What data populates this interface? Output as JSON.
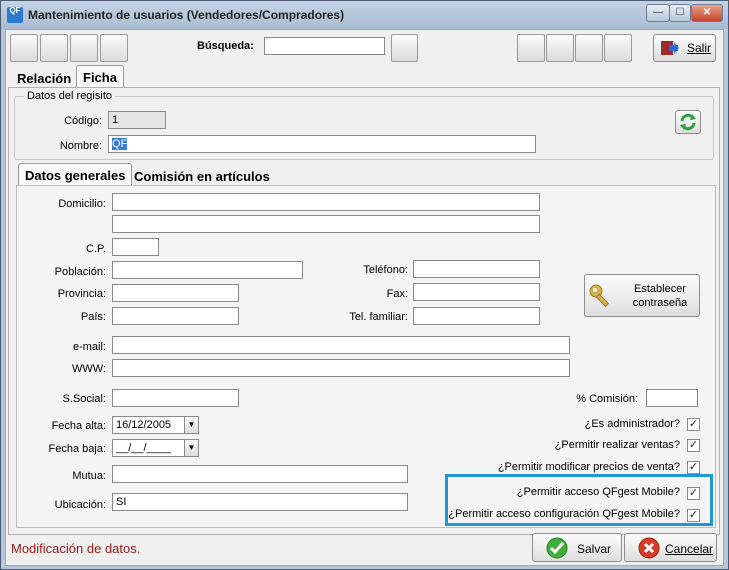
{
  "window": {
    "title": "Mantenimiento de usuarios (Vendedores/Compradores)",
    "app_icon_text": "QF",
    "min_label": "—",
    "max_label": "☐",
    "close_label": "✕"
  },
  "toolbar": {
    "search_label": "Búsqueda:",
    "search_value": "",
    "exit_label": "Salir"
  },
  "tabs": {
    "main": [
      "Relación",
      "Ficha"
    ],
    "main_active": "Ficha",
    "sub": [
      "Datos generales",
      "Comisión en artículos"
    ],
    "sub_active": "Datos generales"
  },
  "registry": {
    "group_title": "Datos del regisito",
    "codigo_label": "Código:",
    "codigo_value": "1",
    "nombre_label": "Nombre:",
    "nombre_value": "QF"
  },
  "form": {
    "domicilio_label": "Domicilio:",
    "domicilio_1": "",
    "domicilio_2": "",
    "cp_label": "C.P.",
    "cp_value": "",
    "poblacion_label": "Población:",
    "poblacion_value": "",
    "provincia_label": "Provincia:",
    "provincia_value": "",
    "pais_label": "País:",
    "pais_value": "",
    "telefono_label": "Teléfono:",
    "telefono_value": "",
    "fax_label": "Fax:",
    "fax_value": "",
    "telfam_label": "Tel. familiar:",
    "telfam_value": "",
    "email_label": "e-mail:",
    "email_value": "",
    "www_label": "WWW:",
    "www_value": "",
    "ssocial_label": "S.Social:",
    "ssocial_value": "",
    "comision_label": "% Comisión:",
    "comision_value": "",
    "fecha_alta_label": "Fecha alta:",
    "fecha_alta_value": "16/12/2005",
    "fecha_baja_label": "Fecha baja:",
    "fecha_baja_value": "__/__/____",
    "mutua_label": "Mutua:",
    "mutua_value": "",
    "ubicacion_label": "Ubicación:",
    "ubicacion_value": "SI",
    "password_button": "Establecer contraseña"
  },
  "checks": [
    {
      "label": "¿Es administrador?",
      "checked": true
    },
    {
      "label": "¿Permitir realizar ventas?",
      "checked": true
    },
    {
      "label": "¿Permitir modificar precios de venta?",
      "checked": true
    },
    {
      "label": "¿Permitir acceso QFgest Mobile?",
      "checked": true
    },
    {
      "label": "¿Permitir acceso configuración QFgest Mobile?",
      "checked": true
    }
  ],
  "check_mark": "✓",
  "dropdown_arrow": "▼",
  "status": {
    "message": "Modificación de datos.",
    "save_label": "Salvar",
    "cancel_label": "Cancelar"
  },
  "colors": {
    "highlight": "#1d97d8",
    "status_text": "#8b1a1a"
  }
}
